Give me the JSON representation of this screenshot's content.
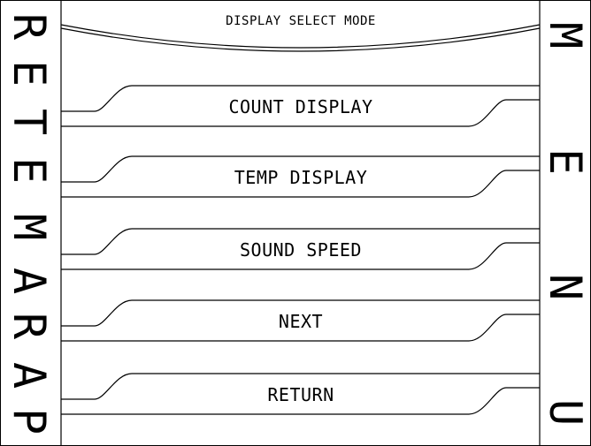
{
  "left_banner": {
    "letters": [
      "P",
      "A",
      "R",
      "A",
      "M",
      "E",
      "T",
      "E",
      "R"
    ]
  },
  "right_banner": {
    "letters": [
      "M",
      "E",
      "N",
      "U"
    ]
  },
  "header": {
    "title": "DISPLAY SELECT MODE"
  },
  "menu": {
    "items": [
      {
        "label": "COUNT DISPLAY"
      },
      {
        "label": "TEMP DISPLAY"
      },
      {
        "label": "SOUND SPEED"
      },
      {
        "label": "NEXT"
      },
      {
        "label": "RETURN"
      }
    ]
  },
  "colors": {
    "background": "#ffffff",
    "line": "#000000"
  }
}
